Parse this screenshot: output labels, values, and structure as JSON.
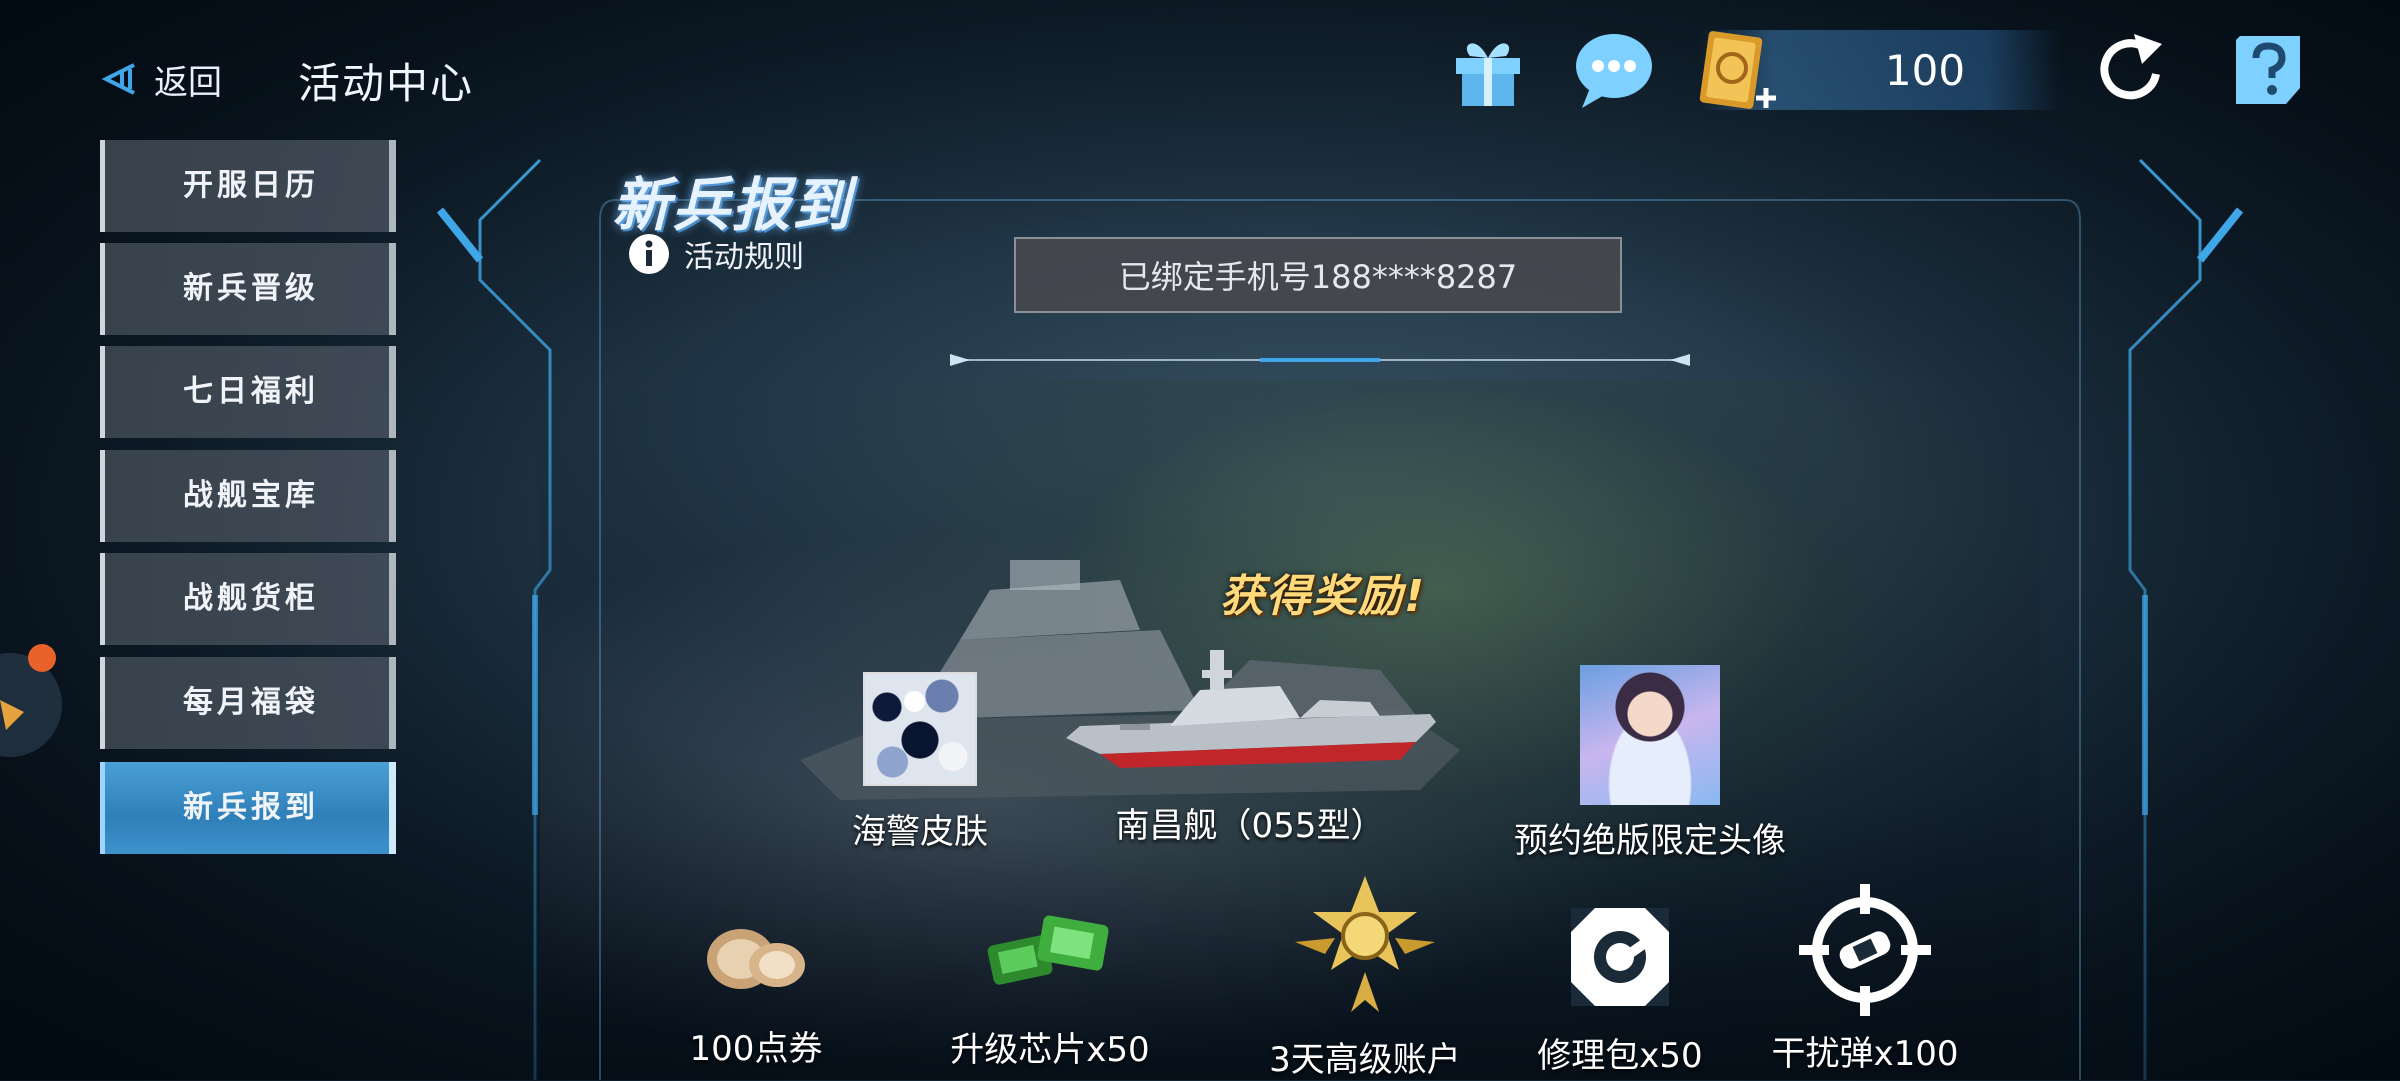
{
  "header": {
    "back_label": "返回",
    "title": "活动中心",
    "icons": [
      "gift-icon",
      "chat-bubble-icon",
      "card-plus-icon",
      "refresh-icon",
      "help-icon"
    ],
    "currency_value": "100"
  },
  "sidebar": {
    "items": [
      {
        "label": "开服日历",
        "active": false
      },
      {
        "label": "新兵晋级",
        "active": false
      },
      {
        "label": "七日福利",
        "active": false
      },
      {
        "label": "战舰宝库",
        "active": false
      },
      {
        "label": "战舰货柜",
        "active": false
      },
      {
        "label": "每月福袋",
        "active": false
      },
      {
        "label": "新兵报到",
        "active": true
      }
    ]
  },
  "main": {
    "title": "新兵报到",
    "rules_label": "活动规则",
    "phone_text": "已绑定手机号188****8287",
    "reward_heading": "获得奖励!",
    "top_rewards": [
      {
        "label": "海警皮肤",
        "icon": "camo-skin-icon"
      },
      {
        "label": "南昌舰（055型）",
        "icon": "destroyer-ship-icon"
      },
      {
        "label": "预约绝版限定头像",
        "icon": "avatar-portrait-icon"
      }
    ],
    "bottom_rewards": [
      {
        "label": "100点券",
        "icon": "coupon-coins-icon"
      },
      {
        "label": "升级芯片x50",
        "icon": "chip-icon"
      },
      {
        "label": "3天高级账户",
        "icon": "premium-badge-icon"
      },
      {
        "label": "修理包x50",
        "icon": "repair-kit-icon"
      },
      {
        "label": "干扰弹x100",
        "icon": "decoy-icon"
      }
    ]
  },
  "colors": {
    "accent_blue": "#4a9fd6",
    "gold": "#ffd97a",
    "frame_cyan": "#3fa7e8"
  }
}
